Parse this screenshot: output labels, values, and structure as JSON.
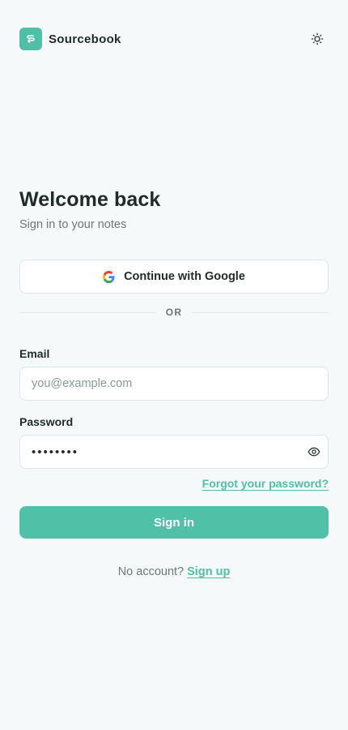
{
  "app": {
    "name": "Sourcebook",
    "logo_icon": "swap-arrows-icon",
    "theme_icon": "sun-icon"
  },
  "auth": {
    "title": "Welcome back",
    "subtitle": "Sign in to your notes",
    "google_label": "Continue with Google",
    "divider_text": "OR",
    "email_label": "Email",
    "email_placeholder": "you@example.com",
    "email_value": "",
    "password_label": "Password",
    "password_value": "••••••••",
    "show_password_icon": "eye-icon",
    "forgot_label": "Forgot your password?",
    "submit_label": "Sign in",
    "signup_prompt": "No account?",
    "signup_link": "Sign up"
  },
  "colors": {
    "accent": "#50c1a7",
    "background": "#f5f9f9",
    "text": "#1f2a2a",
    "muted": "#6b7878",
    "border": "#dde6e6"
  }
}
